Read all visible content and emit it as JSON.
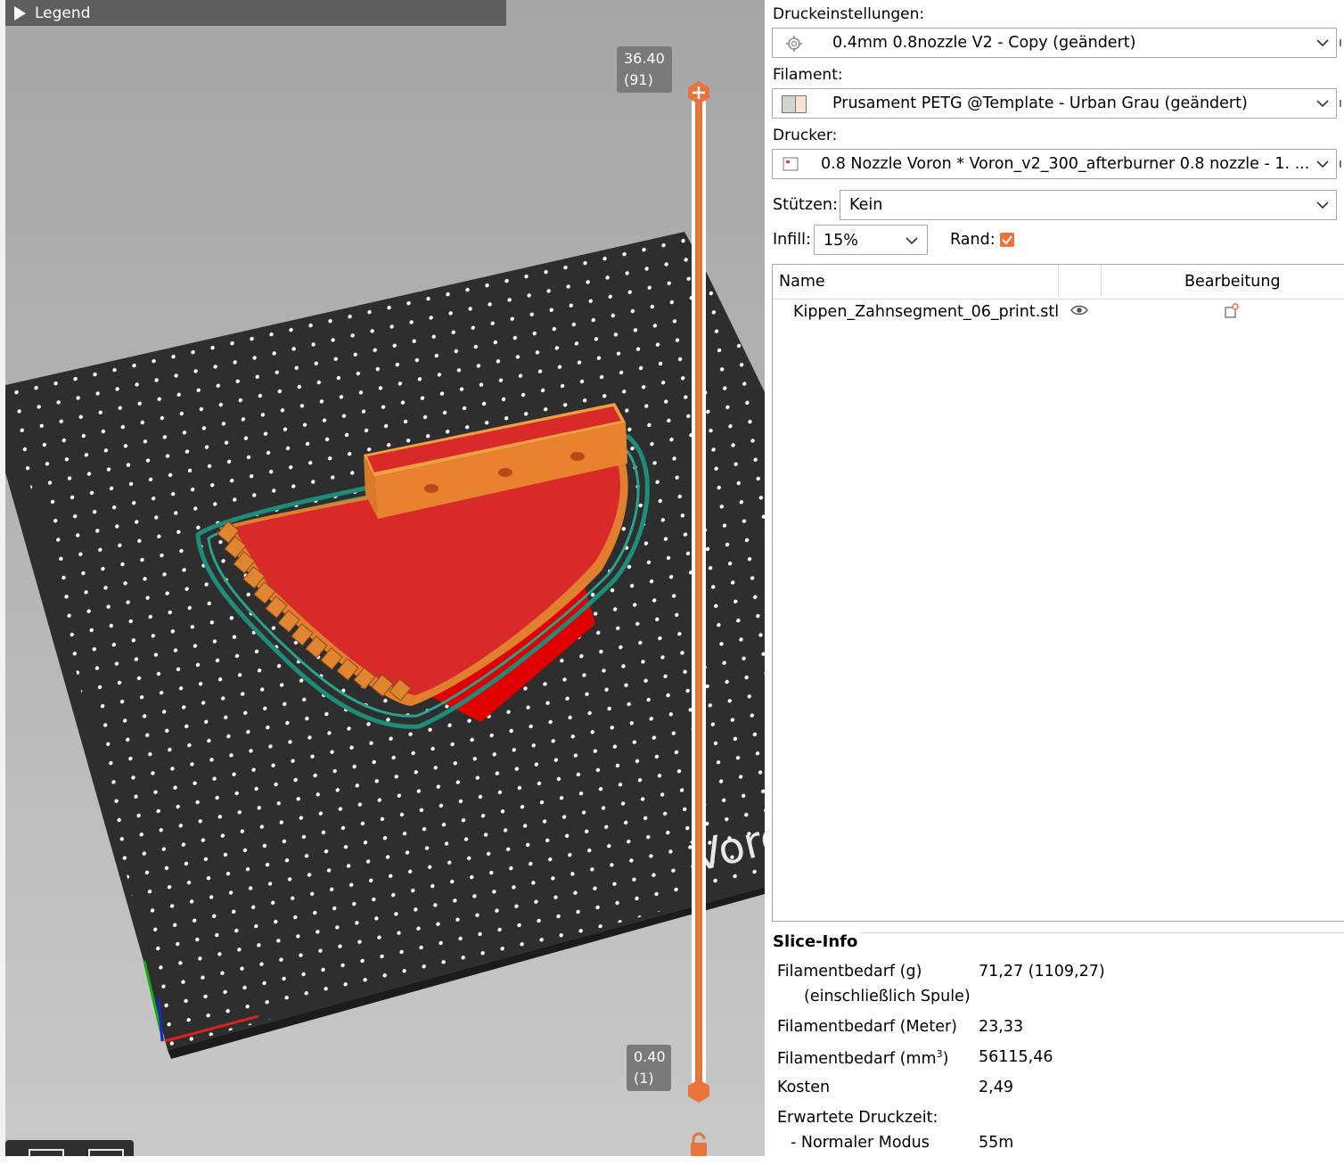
{
  "viewport": {
    "legend_label": "Legend",
    "bed_logo_text": "Voron",
    "slider": {
      "top_height": "36.40",
      "top_layer": "(91)",
      "bottom_height": "0.40",
      "bottom_layer": "(1)",
      "accent_color": "#e7743a"
    },
    "icons": [
      "play-triangle-icon",
      "plus-icon",
      "lock-icon"
    ]
  },
  "panel": {
    "print_settings": {
      "label": "Druckeinstellungen:",
      "value": "0.4mm 0.8nozzle V2 - Copy (geändert)",
      "icon": "gear-icon"
    },
    "filament": {
      "label": "Filament:",
      "value": "Prusament PETG @Template - Urban Grau (geändert)",
      "icon": "filament-swatch-icon"
    },
    "printer": {
      "label": "Drucker:",
      "value": "0.8 Nozzle Voron  * Voron_v2_300_afterburner 0.8 nozzle - 1. ...",
      "icon": "printer-icon"
    },
    "supports": {
      "label": "Stützen:",
      "value": "Kein"
    },
    "infill": {
      "label": "Infill:",
      "value": "15%"
    },
    "brim": {
      "label": "Rand:",
      "checked": true
    },
    "object_list": {
      "columns": [
        "Name",
        "Bearbeitung"
      ],
      "rows": [
        {
          "name": "Kippen_Zahnsegment_06_print.stl"
        }
      ]
    },
    "slice_info": {
      "title": "Slice-Info",
      "filament_g_label": "Filamentbedarf (g)",
      "filament_g_sub": "(einschließlich Spule)",
      "filament_g_value": "71,27 (1109,27)",
      "filament_m_label": "Filamentbedarf (Meter)",
      "filament_m_value": "23,33",
      "filament_mm3_label": "Filamentbedarf (mm",
      "filament_mm3_sup": "3",
      "filament_mm3_close": ")",
      "filament_mm3_value": "56115,46",
      "cost_label": "Kosten",
      "cost_value": "2,49",
      "time_label": "Erwartete Druckzeit:",
      "normal_mode_label": "- Normaler Modus",
      "normal_mode_value": "55m"
    }
  }
}
